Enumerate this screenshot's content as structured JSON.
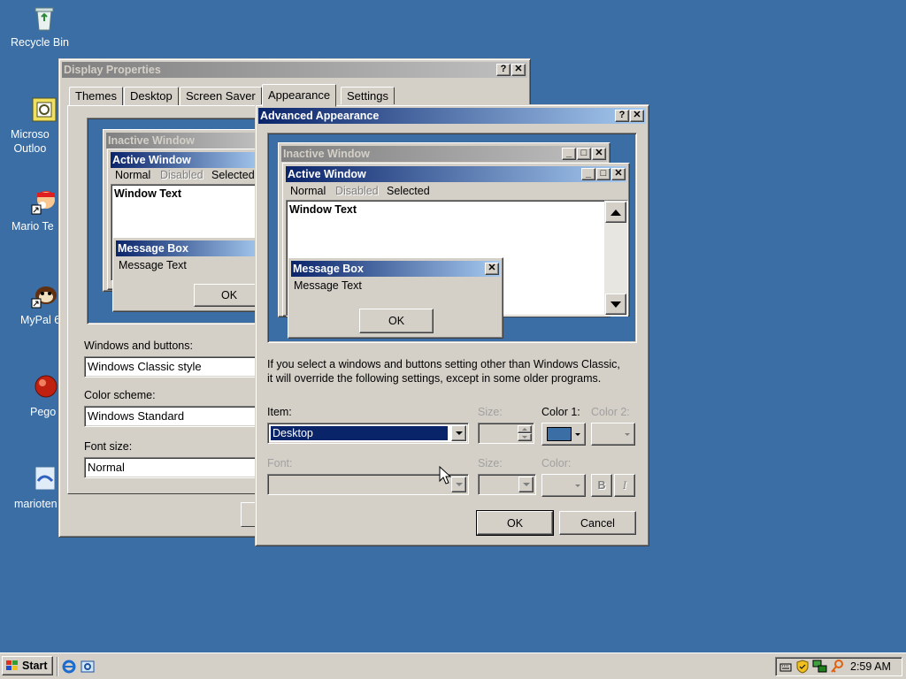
{
  "desktop": {
    "icons": [
      {
        "label": "Recycle Bin"
      },
      {
        "label": "Microsoft Outlook",
        "line1": "Microso",
        "line2": "Outloo"
      },
      {
        "label": "Mario Te"
      },
      {
        "label": "MyPal 6"
      },
      {
        "label": "Pego"
      },
      {
        "label": "marioten"
      }
    ]
  },
  "display_properties": {
    "title": "Display Properties",
    "tabs": [
      "Themes",
      "Desktop",
      "Screen Saver",
      "Appearance",
      "Settings"
    ],
    "preview": {
      "inactive_title": "Inactive Window",
      "active_title": "Active Window",
      "menu_normal": "Normal",
      "menu_disabled": "Disabled",
      "menu_selected": "Selected",
      "window_text": "Window Text",
      "msgbox_title": "Message Box",
      "msgbox_text": "Message Text",
      "ok": "OK"
    },
    "windows_buttons_label": "Windows and buttons:",
    "windows_buttons_value": "Windows Classic style",
    "color_scheme_label": "Color scheme:",
    "color_scheme_value": "Windows Standard",
    "font_size_label": "Font size:",
    "font_size_value": "Normal"
  },
  "advanced": {
    "title": "Advanced Appearance",
    "preview": {
      "inactive_title": "Inactive Window",
      "active_title": "Active Window",
      "menu_normal": "Normal",
      "menu_disabled": "Disabled",
      "menu_selected": "Selected",
      "window_text": "Window Text",
      "msgbox_title": "Message Box",
      "msgbox_text": "Message Text",
      "ok": "OK"
    },
    "info_line1": "If you select a windows and buttons setting other than Windows Classic,",
    "info_line2": "it will override the following settings, except in some older programs.",
    "item_label": "Item:",
    "item_value": "Desktop",
    "size_label": "Size:",
    "color1_label": "Color 1:",
    "color2_label": "Color 2:",
    "font_label": "Font:",
    "font_size_label": "Size:",
    "font_color_label": "Color:",
    "bold_label": "B",
    "italic_label": "I",
    "ok_label": "OK",
    "cancel_label": "Cancel",
    "desktop_color": "#3a6ea5"
  },
  "taskbar": {
    "start_label": "Start",
    "clock": "2:59 AM"
  }
}
